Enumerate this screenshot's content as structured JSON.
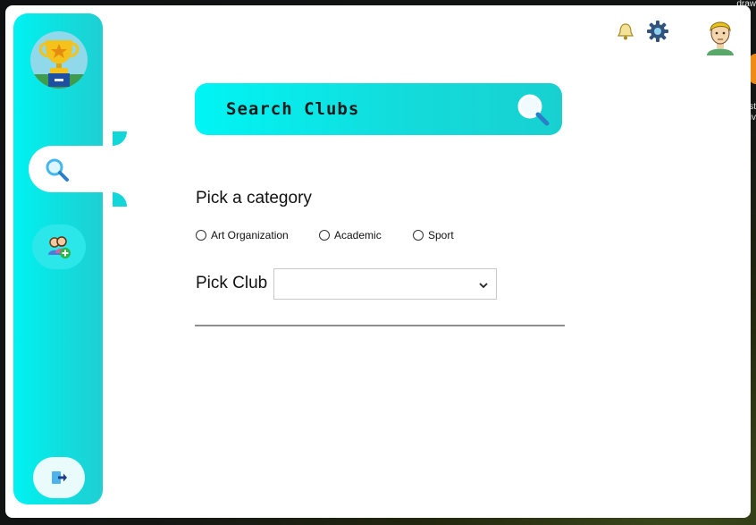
{
  "app": {
    "icons": {
      "logo": "trophy-icon",
      "sidebar_search": "search-icon",
      "sidebar_groups": "group-add-icon",
      "sidebar_logout": "logout-icon",
      "notifications": "bell-icon",
      "settings": "gear-icon",
      "profile": "avatar-icon",
      "banner_search": "search-icon",
      "dropdown": "chevron-down-icon"
    },
    "colors": {
      "accent": "#00f2f2",
      "accent_dark": "#18d0d0",
      "window_bg": "#ffffff"
    }
  },
  "search": {
    "title": "Search Clubs"
  },
  "category": {
    "heading": "Pick a category",
    "options": [
      {
        "label": "Art Organization",
        "selected": false
      },
      {
        "label": "Academic",
        "selected": false
      },
      {
        "label": "Sport",
        "selected": false
      }
    ]
  },
  "club": {
    "label": "Pick Club",
    "selected_value": ""
  },
  "desktop": {
    "edge_text_1": "draw",
    "edge_text_2": "st",
    "edge_text_3": "iv"
  }
}
